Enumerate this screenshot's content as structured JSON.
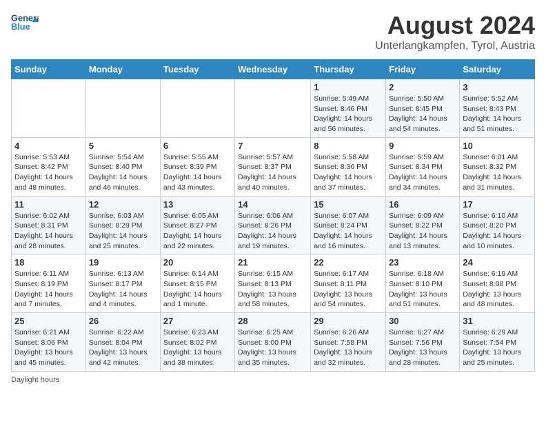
{
  "header": {
    "logo_line1": "General",
    "logo_line2": "Blue",
    "title": "August 2024",
    "subtitle": "Unterlangkampfen, Tyrol, Austria"
  },
  "weekdays": [
    "Sunday",
    "Monday",
    "Tuesday",
    "Wednesday",
    "Thursday",
    "Friday",
    "Saturday"
  ],
  "weeks": [
    [
      {
        "day": "",
        "info": ""
      },
      {
        "day": "",
        "info": ""
      },
      {
        "day": "",
        "info": ""
      },
      {
        "day": "",
        "info": ""
      },
      {
        "day": "1",
        "info": "Sunrise: 5:49 AM\nSunset: 8:46 PM\nDaylight: 14 hours\nand 56 minutes."
      },
      {
        "day": "2",
        "info": "Sunrise: 5:50 AM\nSunset: 8:45 PM\nDaylight: 14 hours\nand 54 minutes."
      },
      {
        "day": "3",
        "info": "Sunrise: 5:52 AM\nSunset: 8:43 PM\nDaylight: 14 hours\nand 51 minutes."
      }
    ],
    [
      {
        "day": "4",
        "info": "Sunrise: 5:53 AM\nSunset: 8:42 PM\nDaylight: 14 hours\nand 48 minutes."
      },
      {
        "day": "5",
        "info": "Sunrise: 5:54 AM\nSunset: 8:40 PM\nDaylight: 14 hours\nand 46 minutes."
      },
      {
        "day": "6",
        "info": "Sunrise: 5:55 AM\nSunset: 8:39 PM\nDaylight: 14 hours\nand 43 minutes."
      },
      {
        "day": "7",
        "info": "Sunrise: 5:57 AM\nSunset: 8:37 PM\nDaylight: 14 hours\nand 40 minutes."
      },
      {
        "day": "8",
        "info": "Sunrise: 5:58 AM\nSunset: 8:36 PM\nDaylight: 14 hours\nand 37 minutes."
      },
      {
        "day": "9",
        "info": "Sunrise: 5:59 AM\nSunset: 8:34 PM\nDaylight: 14 hours\nand 34 minutes."
      },
      {
        "day": "10",
        "info": "Sunrise: 6:01 AM\nSunset: 8:32 PM\nDaylight: 14 hours\nand 31 minutes."
      }
    ],
    [
      {
        "day": "11",
        "info": "Sunrise: 6:02 AM\nSunset: 8:31 PM\nDaylight: 14 hours\nand 28 minutes."
      },
      {
        "day": "12",
        "info": "Sunrise: 6:03 AM\nSunset: 8:29 PM\nDaylight: 14 hours\nand 25 minutes."
      },
      {
        "day": "13",
        "info": "Sunrise: 6:05 AM\nSunset: 8:27 PM\nDaylight: 14 hours\nand 22 minutes."
      },
      {
        "day": "14",
        "info": "Sunrise: 6:06 AM\nSunset: 8:26 PM\nDaylight: 14 hours\nand 19 minutes."
      },
      {
        "day": "15",
        "info": "Sunrise: 6:07 AM\nSunset: 8:24 PM\nDaylight: 14 hours\nand 16 minutes."
      },
      {
        "day": "16",
        "info": "Sunrise: 6:09 AM\nSunset: 8:22 PM\nDaylight: 14 hours\nand 13 minutes."
      },
      {
        "day": "17",
        "info": "Sunrise: 6:10 AM\nSunset: 8:20 PM\nDaylight: 14 hours\nand 10 minutes."
      }
    ],
    [
      {
        "day": "18",
        "info": "Sunrise: 6:11 AM\nSunset: 8:19 PM\nDaylight: 14 hours\nand 7 minutes."
      },
      {
        "day": "19",
        "info": "Sunrise: 6:13 AM\nSunset: 8:17 PM\nDaylight: 14 hours\nand 4 minutes."
      },
      {
        "day": "20",
        "info": "Sunrise: 6:14 AM\nSunset: 8:15 PM\nDaylight: 14 hours\nand 1 minute."
      },
      {
        "day": "21",
        "info": "Sunrise: 6:15 AM\nSunset: 8:13 PM\nDaylight: 13 hours\nand 58 minutes."
      },
      {
        "day": "22",
        "info": "Sunrise: 6:17 AM\nSunset: 8:11 PM\nDaylight: 13 hours\nand 54 minutes."
      },
      {
        "day": "23",
        "info": "Sunrise: 6:18 AM\nSunset: 8:10 PM\nDaylight: 13 hours\nand 51 minutes."
      },
      {
        "day": "24",
        "info": "Sunrise: 6:19 AM\nSunset: 8:08 PM\nDaylight: 13 hours\nand 48 minutes."
      }
    ],
    [
      {
        "day": "25",
        "info": "Sunrise: 6:21 AM\nSunset: 8:06 PM\nDaylight: 13 hours\nand 45 minutes."
      },
      {
        "day": "26",
        "info": "Sunrise: 6:22 AM\nSunset: 8:04 PM\nDaylight: 13 hours\nand 42 minutes."
      },
      {
        "day": "27",
        "info": "Sunrise: 6:23 AM\nSunset: 8:02 PM\nDaylight: 13 hours\nand 38 minutes."
      },
      {
        "day": "28",
        "info": "Sunrise: 6:25 AM\nSunset: 8:00 PM\nDaylight: 13 hours\nand 35 minutes."
      },
      {
        "day": "29",
        "info": "Sunrise: 6:26 AM\nSunset: 7:58 PM\nDaylight: 13 hours\nand 32 minutes."
      },
      {
        "day": "30",
        "info": "Sunrise: 6:27 AM\nSunset: 7:56 PM\nDaylight: 13 hours\nand 28 minutes."
      },
      {
        "day": "31",
        "info": "Sunrise: 6:29 AM\nSunset: 7:54 PM\nDaylight: 13 hours\nand 25 minutes."
      }
    ]
  ],
  "footer": "Daylight hours"
}
